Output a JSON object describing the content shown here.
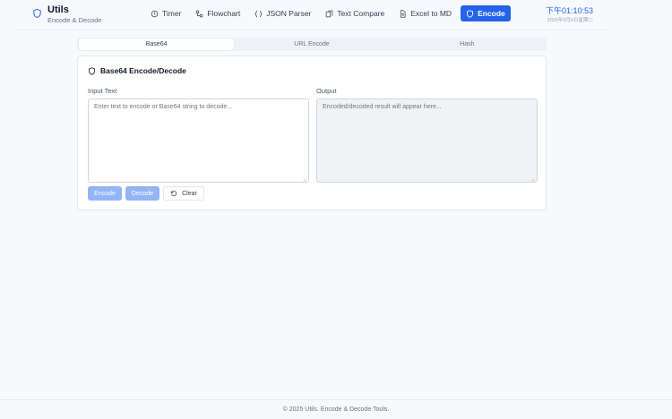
{
  "brand": {
    "title": "Utils",
    "subtitle": "Encode & Decode",
    "icon": "shield-icon",
    "accent": "#2563eb"
  },
  "nav": {
    "items": [
      {
        "label": "Timer",
        "icon": "clock-icon"
      },
      {
        "label": "Flowchart",
        "icon": "workflow-icon"
      },
      {
        "label": "JSON Parser",
        "icon": "braces-icon"
      },
      {
        "label": "Text Compare",
        "icon": "compare-icon"
      },
      {
        "label": "Excel to MD",
        "icon": "file-text-icon"
      },
      {
        "label": "Encode",
        "icon": "shield-icon"
      }
    ],
    "active": "Encode"
  },
  "clock": {
    "time": "下午01:10:53",
    "date": "2025年9月9日星期二"
  },
  "tabs": {
    "items": [
      "Base64",
      "URL Encode",
      "Hash"
    ],
    "active": "Base64"
  },
  "card": {
    "title": "Base64 Encode/Decode",
    "input_label": "Input Text",
    "input_placeholder": "Enter text to encode or Base64 string to decode...",
    "input_value": "",
    "output_label": "Output",
    "output_placeholder": "Encoded/decoded result will appear here...",
    "output_value": ""
  },
  "actions": {
    "encode_label": "Encode",
    "decode_label": "Decode",
    "clear_label": "Clear"
  },
  "footer": {
    "text": "© 2025 Utils. Encode & Decode Tools."
  },
  "colors": {
    "primary": "#2563eb",
    "primary_disabled": "#93b4f5",
    "background": "#f7f9fc",
    "output_bg": "#f0f3f6"
  }
}
